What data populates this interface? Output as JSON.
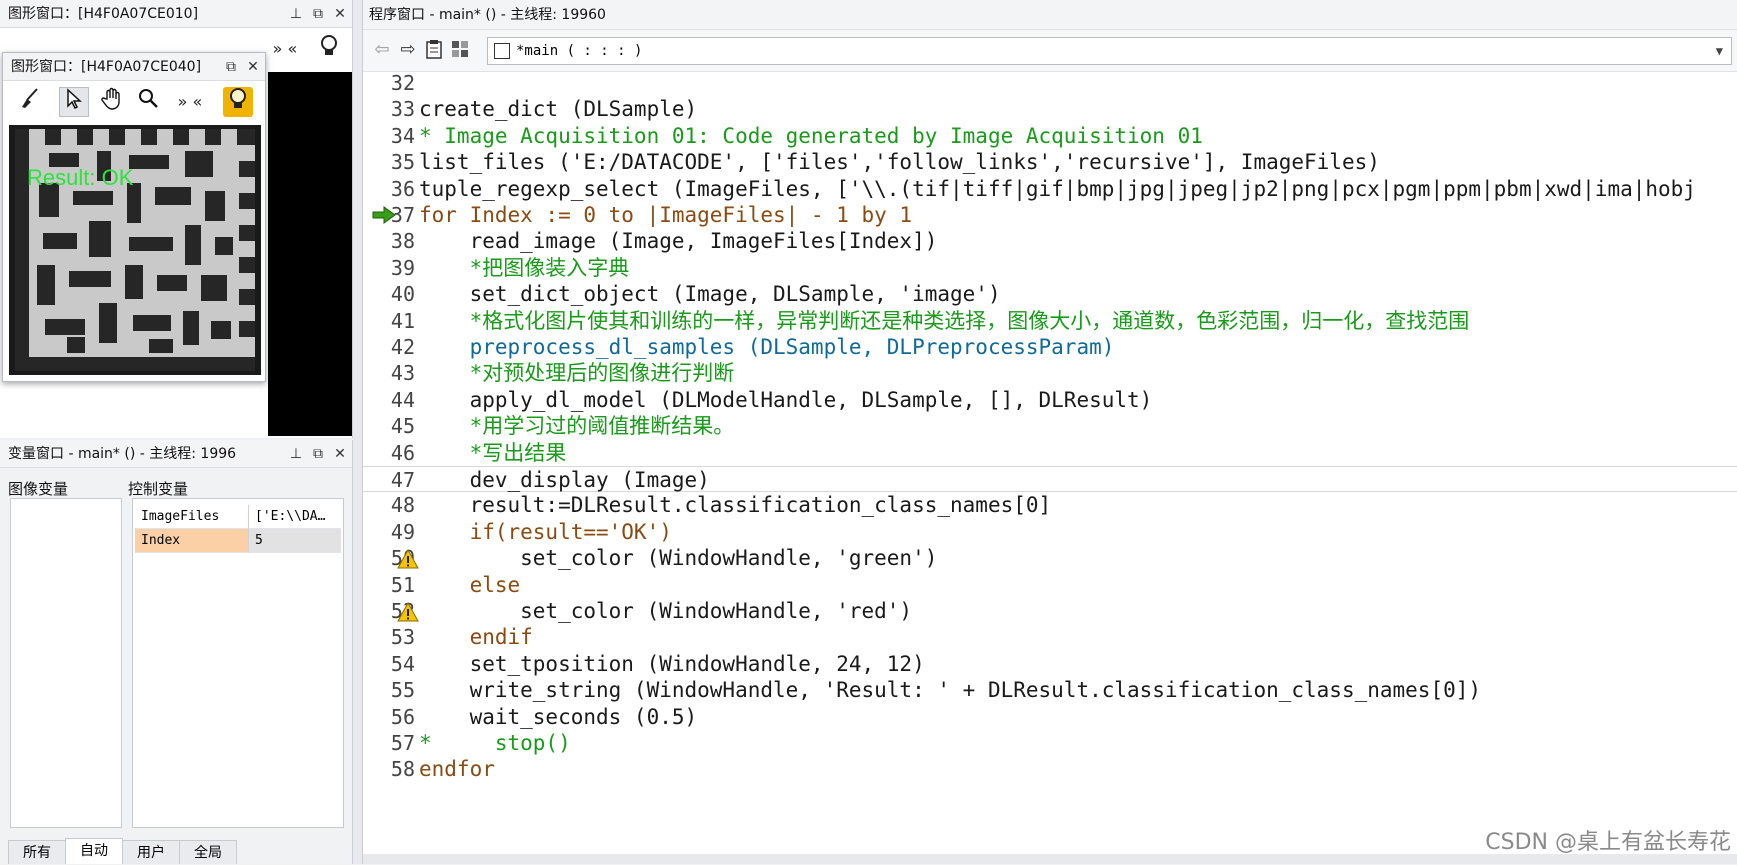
{
  "graphics_window_1": {
    "title": "图形窗口：[H4F0A07CE010]",
    "buttons": [
      "pin-icon",
      "restore-icon",
      "close-icon"
    ],
    "overflow": "» «"
  },
  "graphics_window_2": {
    "title": "图形窗口：[H4F0A07CE040]",
    "overflow": "» «",
    "result_text": "Result: OK",
    "result_color": "#2ee23c"
  },
  "variable_window": {
    "title": "变量窗口 - main* () - 主线程: 1996",
    "image_vars_label": "图像变量",
    "control_vars_label": "控制变量",
    "control_vars": [
      {
        "name": "ImageFiles",
        "value": "['E:\\\\DA…"
      },
      {
        "name": "Index",
        "value": "5"
      }
    ],
    "tabs": [
      "所有",
      "自动",
      "用户",
      "全局"
    ],
    "active_tab": "自动"
  },
  "program_window": {
    "title": "程序窗口 - main* () - 主线程: 19960",
    "procedure_selector": "*main ( : : : )",
    "current_line": "37",
    "lines": [
      {
        "n": "32",
        "t": ""
      },
      {
        "n": "33",
        "t": "create_dict (DLSample)"
      },
      {
        "n": "34",
        "t": "* Image Acquisition 01: Code generated by Image Acquisition 01"
      },
      {
        "n": "35",
        "t": "list_files ('E:/DATACODE', ['files','follow_links','recursive'], ImageFiles)"
      },
      {
        "n": "36",
        "t": "tuple_regexp_select (ImageFiles, ['\\\\.(tif|tiff|gif|bmp|jpg|jpeg|jp2|png|pcx|pgm|ppm|pbm|xwd|ima|hobj"
      },
      {
        "n": "37",
        "t": "for Index := 0 to |ImageFiles| - 1 by 1"
      },
      {
        "n": "38",
        "t": "    read_image (Image, ImageFiles[Index])"
      },
      {
        "n": "39",
        "t": "    *把图像装入字典"
      },
      {
        "n": "40",
        "t": "    set_dict_object (Image, DLSample, 'image')"
      },
      {
        "n": "41",
        "t": "    *格式化图片使其和训练的一样，异常判断还是种类选择，图像大小，通道数，色彩范围，归一化，查找范围"
      },
      {
        "n": "42",
        "t": "    preprocess_dl_samples (DLSample, DLPreprocessParam)"
      },
      {
        "n": "43",
        "t": "    *对预处理后的图像进行判断"
      },
      {
        "n": "44",
        "t": "    apply_dl_model (DLModelHandle, DLSample, [], DLResult)"
      },
      {
        "n": "45",
        "t": "    *用学习过的阈值推断结果。"
      },
      {
        "n": "46",
        "t": "    *写出结果"
      },
      {
        "n": "47",
        "t": "    dev_display (Image)"
      },
      {
        "n": "48",
        "t": "    result:=DLResult.classification_class_names[0]"
      },
      {
        "n": "49",
        "t": "    if(result=='OK')"
      },
      {
        "n": "50",
        "t": "        set_color (WindowHandle, 'green')"
      },
      {
        "n": "51",
        "t": "    else"
      },
      {
        "n": "52",
        "t": "        set_color (WindowHandle, 'red')"
      },
      {
        "n": "53",
        "t": "    endif"
      },
      {
        "n": "54",
        "t": "    set_tposition (WindowHandle, 24, 12)"
      },
      {
        "n": "55",
        "t": "    write_string (WindowHandle, 'Result: ' + DLResult.classification_class_names[0])"
      },
      {
        "n": "56",
        "t": "    wait_seconds (0.5)"
      },
      {
        "n": "57",
        "t": "*     stop()"
      },
      {
        "n": "58",
        "t": "endfor"
      }
    ]
  },
  "watermark": "CSDN @桌上有盆长寿花",
  "colors": {
    "comment": "#1a9a1a",
    "control_keyword": "#8b4a12",
    "procedure": "#0f6a9a",
    "selected_var": "#fbd0a6",
    "bulb": "#f0b400"
  }
}
